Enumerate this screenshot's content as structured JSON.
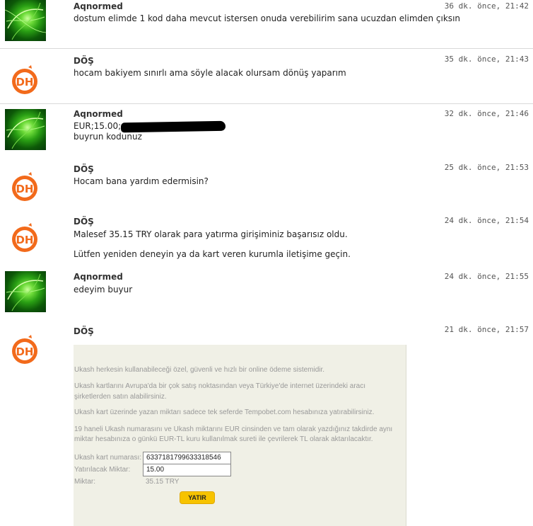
{
  "messages": [
    {
      "author": "Aqnormed",
      "time": "36 dk. önce, 21:42",
      "lines": [
        "dostum elimde 1 kod daha mevcut istersen onuda verebilirim sana ucuzdan elimden çıksın"
      ]
    },
    {
      "author": "DÖŞ",
      "time": "35 dk. önce, 21:43",
      "lines": [
        "hocam bakiyem sınırlı ama söyle alacak olursam dönüş yaparım"
      ]
    },
    {
      "author": "Aqnormed",
      "time": "32 dk. önce, 21:46",
      "lines": [
        "EUR;15.00;",
        "buyrun kodunuz"
      ]
    },
    {
      "author": "DÖŞ",
      "time": "25 dk. önce, 21:53",
      "lines": [
        "Hocam bana yardım edermisin?"
      ]
    },
    {
      "author": "DÖŞ",
      "time": "24 dk. önce, 21:54",
      "lines": [
        "Malesef 35.15 TRY olarak para yatırma girişiminiz başarısız oldu.",
        "Lütfen yeniden deneyin ya da kart veren kurumla iletişime geçin."
      ]
    },
    {
      "author": "Aqnormed",
      "time": "24 dk. önce, 21:55",
      "lines": [
        "edeyim buyur"
      ]
    },
    {
      "author": "DÖŞ",
      "time": "21 dk. önce, 21:57",
      "lines": []
    }
  ],
  "avatar_icons": {
    "aqnormed": "green-fractal-avatar-icon",
    "dos": "dh-orange-logo-icon"
  },
  "ukash_panel": {
    "p1": "Ukash herkesin kullanabileceği özel, güvenli ve hızlı bir online ödeme sistemidir.",
    "p2_l1": "Ukash kartlarını Avrupa'da bir çok satış noktasından veya Türkiye'de internet üzerindeki aracı",
    "p2_l2": "şirketlerden satın alabilirsiniz.",
    "p3": "Ukash kart üzerinde yazan miktarı sadece tek seferde Tempobet.com hesabınıza yatırabilirsiniz.",
    "p4_l1": "19 haneli Ukash numarasını ve Ukash miktarını EUR cinsinden ve tam olarak yazdığınız takdirde aynı",
    "p4_l2": "miktar hesabınıza o günkü EUR-TL kuru kullanılmak sureti ile çevrilerek TL olarak aktarılacaktır.",
    "card_label": "Ukash kart numarası:",
    "card_value": "6337181799633318546",
    "amount_label": "Yatırılacak Miktar:",
    "amount_value": "15.00",
    "total_label": "Miktar:",
    "total_value": "35.15 TRY",
    "submit_label": "YATIR"
  },
  "colors": {
    "button": "#f7c300",
    "panel_bg": "#f0f0e6",
    "dh_orange": "#f26a1b"
  }
}
